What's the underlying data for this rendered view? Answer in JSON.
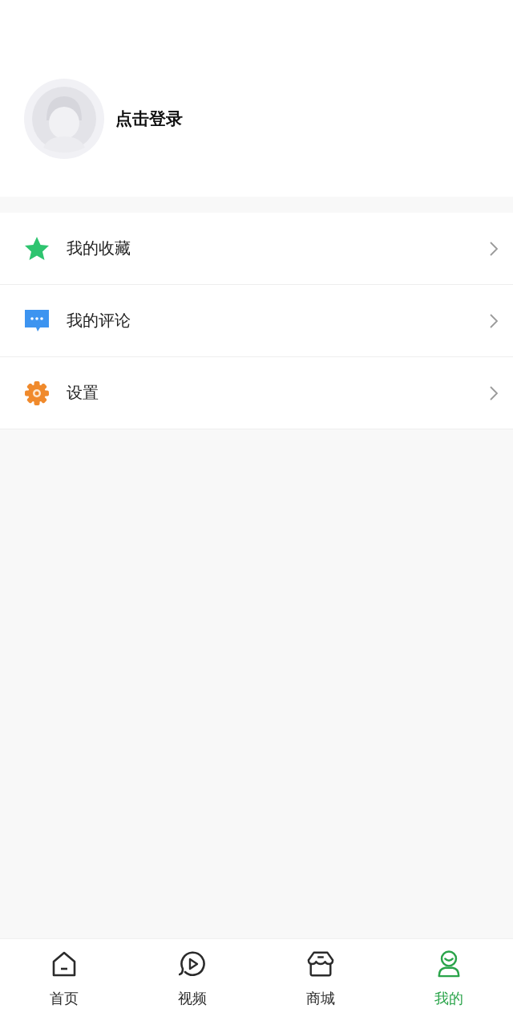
{
  "profile": {
    "login_label": "点击登录"
  },
  "menu": [
    {
      "kind": "star",
      "label": "我的收藏"
    },
    {
      "kind": "chat",
      "label": "我的评论"
    },
    {
      "kind": "gear",
      "label": "设置"
    }
  ],
  "tabs": [
    {
      "kind": "home",
      "label": "首页",
      "selected": false
    },
    {
      "kind": "video",
      "label": "视频",
      "selected": false
    },
    {
      "kind": "store",
      "label": "商城",
      "selected": false
    },
    {
      "kind": "profile",
      "label": "我的",
      "selected": true
    }
  ]
}
